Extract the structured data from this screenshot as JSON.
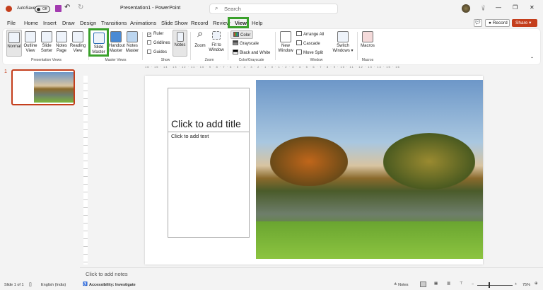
{
  "titlebar": {
    "autosave": "AutoSave",
    "toggle": "Off",
    "title": "Presentation1 - PowerPoint",
    "search_placeholder": "Search",
    "minimize": "—",
    "restore": "❐",
    "close": "✕",
    "lightbulb": "💡"
  },
  "tabs": [
    "File",
    "Home",
    "Insert",
    "Draw",
    "Design",
    "Transitions",
    "Animations",
    "Slide Show",
    "Record",
    "Review",
    "View",
    "Help"
  ],
  "actions": {
    "comment": "💬",
    "record": "Record",
    "share": "Share"
  },
  "ribbon": {
    "presentation_views": {
      "label": "Presentation Views",
      "items": [
        "Normal",
        "Outline View",
        "Slide Sorter",
        "Notes Page",
        "Reading View"
      ]
    },
    "master_views": {
      "label": "Master Views",
      "items": [
        "Slide Master",
        "Handout Master",
        "Notes Master"
      ]
    },
    "show": {
      "label": "Show",
      "checks": [
        "Ruler",
        "Gridlines",
        "Guides"
      ],
      "ruler_checked": true,
      "notes": "Notes"
    },
    "zoom": {
      "label": "Zoom",
      "items": [
        "Zoom",
        "Fit to Window"
      ]
    },
    "color": {
      "label": "Color/Grayscale",
      "items": [
        "Color",
        "Grayscale",
        "Black and White"
      ]
    },
    "window": {
      "label": "Window",
      "new_window": "New Window",
      "items": [
        "Arrange All",
        "Cascade",
        "Move Split"
      ],
      "switch": "Switch Windows"
    },
    "macros": {
      "label": "Macros",
      "item": "Macros"
    }
  },
  "ruler": "16 · 15 · 14 · 13 · 12 · 11 · 10 · 9 · 8 · 7 · 6 · 5 · 4 · 3 · 2 · 1 · 0 · 1 · 2 · 3 · 4 · 5 · 6 · 7 · 8 · 9 · 10 · 11 · 12 · 13 · 14 · 15 · 16",
  "thumbnail": {
    "number": "1"
  },
  "slide": {
    "title": "Click to add title",
    "body": "Click to add text"
  },
  "notes": "Click to add notes",
  "status": {
    "slide": "Slide 1 of 1",
    "language": "English (India)",
    "accessibility": "Accessibility: Investigate",
    "notes": "Notes",
    "zoom": "75%"
  },
  "colors": {
    "accent": "#c43e1c",
    "highlight": "#3aa12b"
  }
}
